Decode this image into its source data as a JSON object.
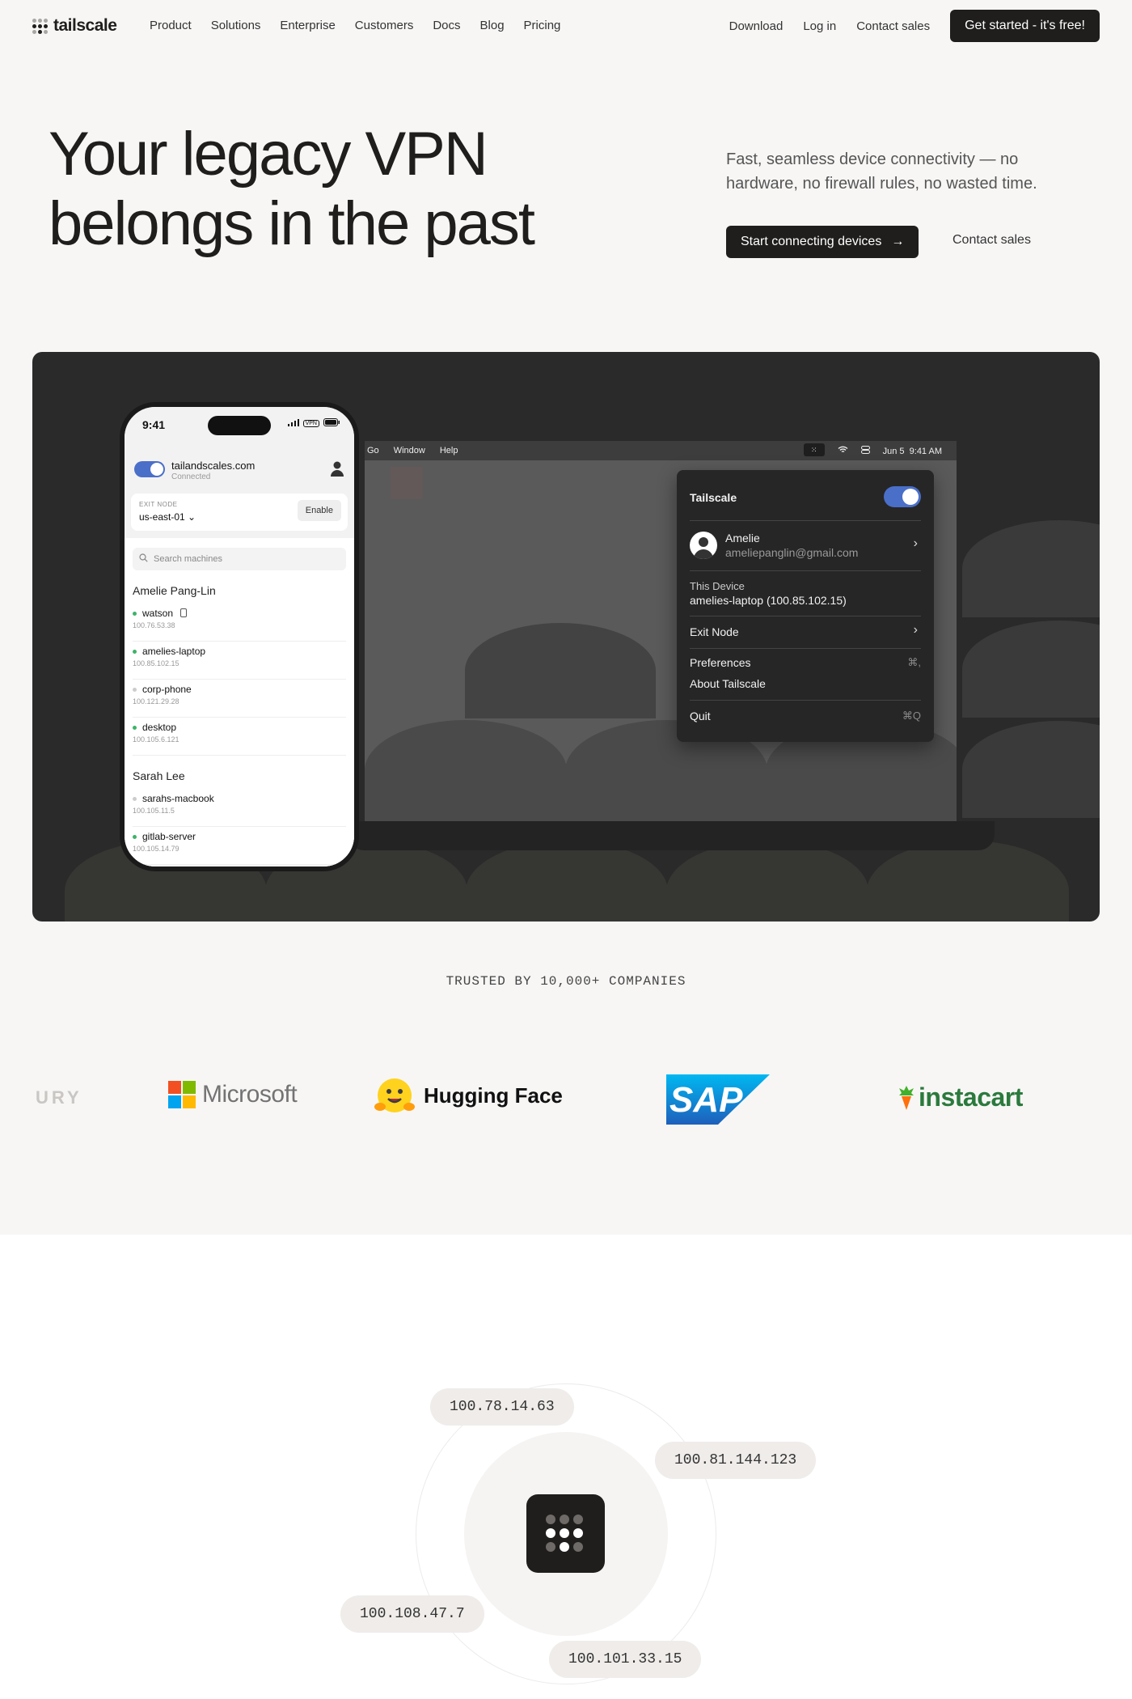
{
  "nav": {
    "brand": "tailscale",
    "links": [
      "Product",
      "Solutions",
      "Enterprise",
      "Customers",
      "Docs",
      "Blog",
      "Pricing"
    ],
    "download": "Download",
    "login": "Log in",
    "contact": "Contact sales",
    "cta": "Get started - it's free!"
  },
  "hero": {
    "title_line1": "Your legacy VPN",
    "title_line2": "belongs in the past",
    "subtitle": "Fast, seamless device connectivity — no hardware, no firewall rules, no wasted time.",
    "cta": "Start connecting devices",
    "cta_arrow": "→",
    "contact": "Contact sales"
  },
  "laptop": {
    "menubar_left": [
      "Go",
      "Window",
      "Help"
    ],
    "menubar_date": "Jun 5",
    "menubar_time": "9:41 AM"
  },
  "ts_menu": {
    "title": "Tailscale",
    "user_name": "Amelie",
    "user_email": "ameliepanglin@gmail.com",
    "device_label": "This Device",
    "device_value": "amelies-laptop (100.85.102.15)",
    "exit_node": "Exit Node",
    "preferences": "Preferences",
    "preferences_shortcut": "⌘,",
    "about": "About Tailscale",
    "quit": "Quit",
    "quit_shortcut": "⌘Q"
  },
  "phone": {
    "time": "9:41",
    "battery": "VPN",
    "domain": "tailandscales.com",
    "status": "Connected",
    "exit_label": "EXIT NODE",
    "exit_value": "us-east-01 ⌄",
    "enable": "Enable",
    "search_placeholder": "Search machines",
    "groups": [
      {
        "name": "Amelie Pang-Lin",
        "machines": [
          {
            "name": "watson",
            "ip": "100.76.53.38",
            "online": true
          },
          {
            "name": "amelies-laptop",
            "ip": "100.85.102.15",
            "online": true
          },
          {
            "name": "corp-phone",
            "ip": "100.121.29.28",
            "online": false
          },
          {
            "name": "desktop",
            "ip": "100.105.6.121",
            "online": true
          }
        ]
      },
      {
        "name": "Sarah Lee",
        "machines": [
          {
            "name": "sarahs-macbook",
            "ip": "100.105.11.5",
            "online": false
          },
          {
            "name": "gitlab-server",
            "ip": "100.105.14.79",
            "online": true
          }
        ]
      }
    ]
  },
  "trusted": {
    "heading": "TRUSTED BY 10,000+ COMPANIES",
    "logos": [
      "URY",
      "Microsoft",
      "Hugging Face",
      "SAP",
      "instacart"
    ]
  },
  "network": {
    "ips": [
      "100.78.14.63",
      "100.81.144.123",
      "100.108.47.7",
      "100.101.33.15"
    ]
  },
  "colors": {
    "accent_toggle": "#4a6fc9",
    "dark": "#1f1e1d",
    "online": "#3db36b"
  }
}
